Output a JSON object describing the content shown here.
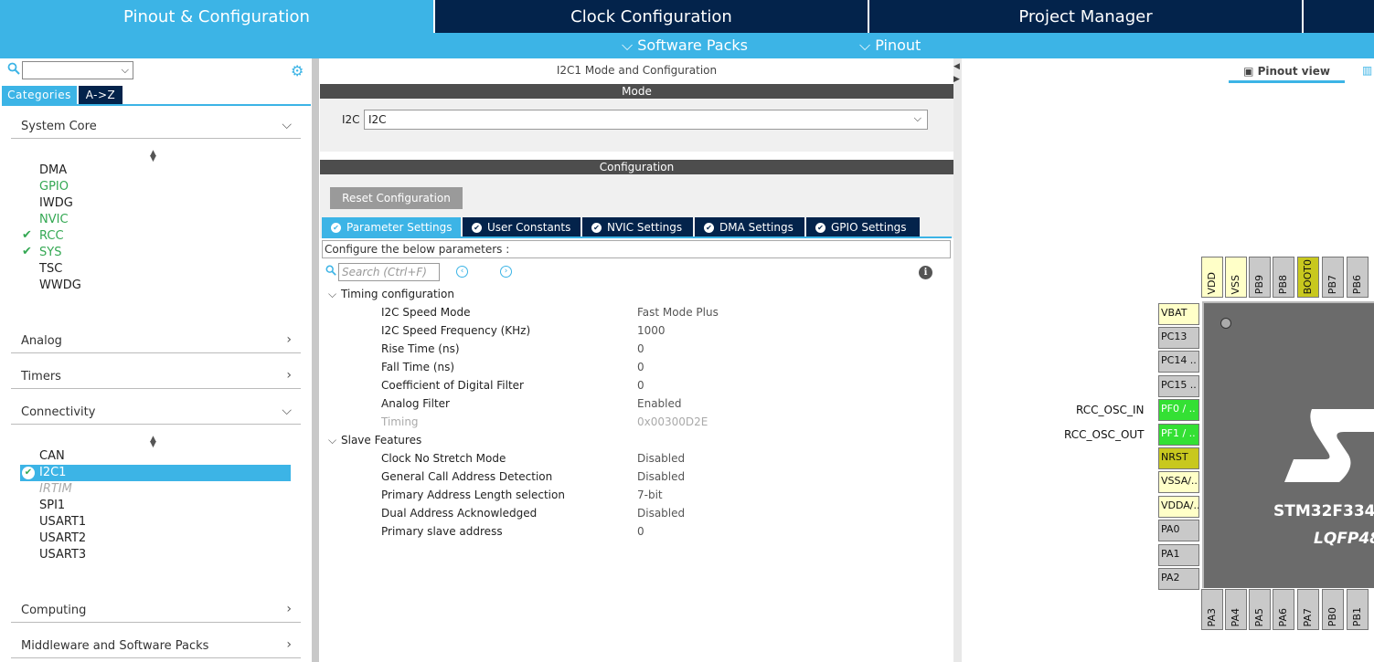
{
  "topnav": {
    "tabs": [
      {
        "label": "Pinout & Configuration"
      },
      {
        "label": "Clock Configuration"
      },
      {
        "label": "Project Manager"
      }
    ],
    "sub": [
      {
        "label": "Software Packs"
      },
      {
        "label": "Pinout"
      }
    ]
  },
  "left": {
    "tabs": [
      {
        "label": "Categories"
      },
      {
        "label": "A->Z"
      }
    ],
    "categories": {
      "system_core": "System Core",
      "analog": "Analog",
      "timers": "Timers",
      "connectivity": "Connectivity",
      "computing": "Computing",
      "middleware": "Middleware and Software Packs"
    },
    "system_core_items": [
      "DMA",
      "GPIO",
      "IWDG",
      "NVIC",
      "RCC",
      "SYS",
      "TSC",
      "WWDG"
    ],
    "connectivity_items": [
      "CAN",
      "I2C1",
      "IRTIM",
      "SPI1",
      "USART1",
      "USART2",
      "USART3"
    ]
  },
  "middle": {
    "title": "I2C1 Mode and Configuration",
    "mode_header": "Mode",
    "mode_label": "I2C",
    "mode_value": "I2C",
    "config_header": "Configuration",
    "reset_button": "Reset Configuration",
    "tabs": [
      {
        "label": "Parameter Settings"
      },
      {
        "label": "User Constants"
      },
      {
        "label": "NVIC Settings"
      },
      {
        "label": "DMA Settings"
      },
      {
        "label": "GPIO Settings"
      }
    ],
    "configure_text": "Configure the below parameters :",
    "search_placeholder": "Search (Ctrl+F)",
    "groups": [
      {
        "name": "Timing configuration",
        "params": [
          {
            "name": "I2C Speed Mode",
            "value": "Fast Mode Plus"
          },
          {
            "name": "I2C Speed Frequency (KHz)",
            "value": "1000"
          },
          {
            "name": "Rise Time (ns)",
            "value": "0"
          },
          {
            "name": "Fall Time (ns)",
            "value": "0"
          },
          {
            "name": "Coefficient of Digital Filter",
            "value": "0"
          },
          {
            "name": "Analog Filter",
            "value": "Enabled"
          },
          {
            "name": "Timing",
            "value": "0x00300D2E"
          }
        ]
      },
      {
        "name": "Slave Features",
        "params": [
          {
            "name": "Clock No Stretch Mode",
            "value": "Disabled"
          },
          {
            "name": "General Call Address Detection",
            "value": "Disabled"
          },
          {
            "name": "Primary Address Length selection",
            "value": "7-bit"
          },
          {
            "name": "Dual Address Acknowledged",
            "value": "Disabled"
          },
          {
            "name": "Primary slave address",
            "value": "0"
          }
        ]
      }
    ]
  },
  "right": {
    "view_label": "Pinout view",
    "chip_name": "STM32F334",
    "package": "LQFP48",
    "top_pins": [
      "VDD",
      "VSS",
      "PB9",
      "PB8",
      "BOOT0",
      "PB7",
      "PB6"
    ],
    "left_pins": [
      "VBAT",
      "PC13",
      "PC14 ..",
      "PC15 ..",
      "PF0 / ..",
      "PF1 / ..",
      "NRST",
      "VSSA/..",
      "VDDA/..",
      "PA0",
      "PA1",
      "PA2"
    ],
    "bottom_pins": [
      "PA3",
      "PA4",
      "PA5",
      "PA6",
      "PA7",
      "PB0",
      "PB1"
    ],
    "ext_labels": [
      "RCC_OSC_IN",
      "RCC_OSC_OUT"
    ]
  },
  "colors": {
    "accent": "#3cb4e6",
    "navy": "#03234b",
    "green": "#34a853",
    "pin_green": "#34e034",
    "pin_gold": "#c8c81e",
    "pin_yellow": "#ffffc8"
  }
}
